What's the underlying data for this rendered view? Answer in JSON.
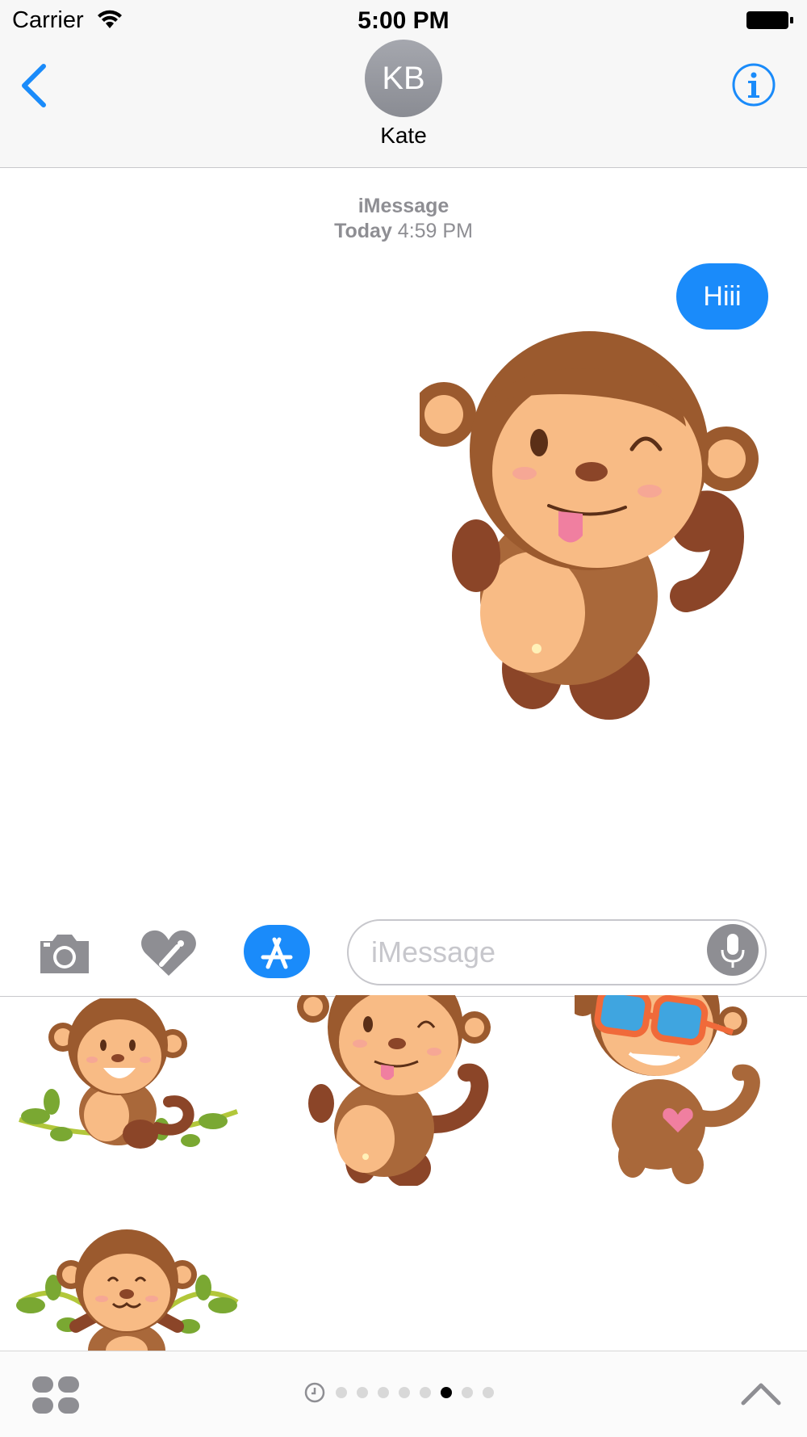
{
  "status_bar": {
    "carrier": "Carrier",
    "time": "5:00 PM"
  },
  "nav": {
    "avatar_initials": "KB",
    "contact_name": "Kate",
    "back_icon": "chevron-left-icon",
    "info_icon": "info-icon"
  },
  "conversation": {
    "service": "iMessage",
    "timestamp_day": "Today",
    "timestamp_time": "4:59 PM",
    "messages": [
      {
        "text": "Hiii"
      }
    ]
  },
  "input": {
    "placeholder": "iMessage"
  },
  "drawer": {
    "page_count": 8,
    "active_page": 6
  },
  "colors": {
    "accent": "#1a8bfa",
    "monkey_brown": "#9b5a2e",
    "monkey_face": "#f8bb85"
  }
}
